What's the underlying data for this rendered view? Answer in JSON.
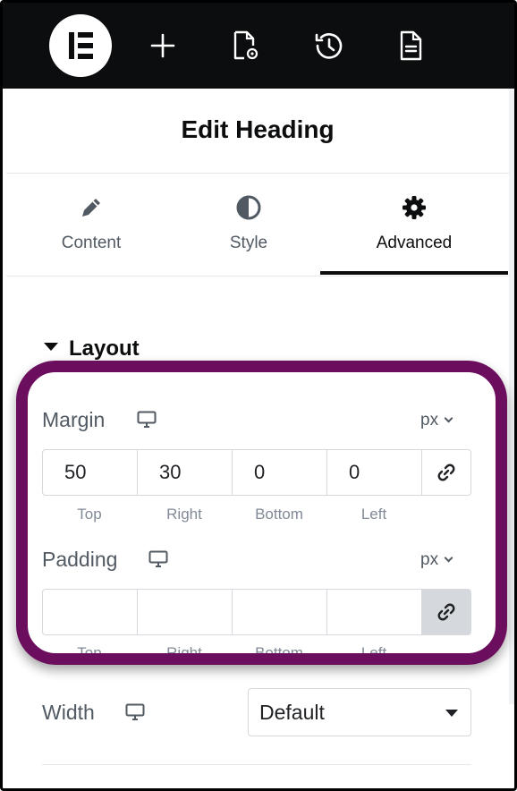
{
  "topbar": {
    "icons": [
      "elementor-logo-icon",
      "add-icon",
      "page-settings-icon",
      "history-icon",
      "notes-icon"
    ]
  },
  "panel": {
    "title": "Edit Heading"
  },
  "tabs": [
    {
      "label": "Content",
      "icon": "pencil-icon"
    },
    {
      "label": "Style",
      "icon": "half-circle-icon"
    },
    {
      "label": "Advanced",
      "icon": "gear-icon",
      "active": true
    }
  ],
  "section": {
    "title": "Layout"
  },
  "margin": {
    "label": "Margin",
    "unit": "px",
    "values": [
      "50",
      "30",
      "0",
      "0"
    ],
    "sublabels": [
      "Top",
      "Right",
      "Bottom",
      "Left"
    ],
    "linked": false
  },
  "padding": {
    "label": "Padding",
    "unit": "px",
    "values": [
      "",
      "",
      "",
      ""
    ],
    "sublabels": [
      "Top",
      "Right",
      "Bottom",
      "Left"
    ],
    "linked": true
  },
  "width": {
    "label": "Width",
    "value": "Default"
  },
  "colors": {
    "topbar": "#0c0d0e",
    "highlight": "#6b0e5e",
    "text_muted": "#515962",
    "border": "#d5d8dc"
  }
}
